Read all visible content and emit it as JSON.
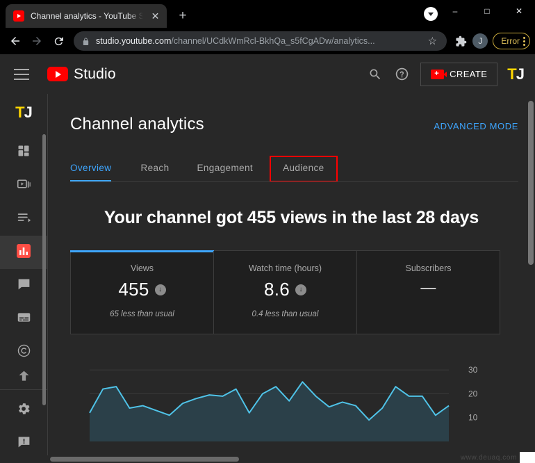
{
  "browser": {
    "tab": {
      "title": "Channel analytics - YouTube Stud",
      "favicon_name": "youtube-favicon",
      "close_label": "✕"
    },
    "new_tab_label": "+",
    "window_controls": {
      "minimize": "–",
      "maximize": "□",
      "close": "✕"
    },
    "toolbar": {
      "back_label": "←",
      "forward_label": "→",
      "reload_label": "⟳",
      "lock_name": "lock-icon",
      "url_host": "studio.youtube.com",
      "url_path": "/channel/UCdkWmRcl-BkhQa_s5fCgADw/analytics...",
      "bookmark_label": "☆",
      "extensions_label": "🧩",
      "avatar_initial": "J",
      "error_label": "Error"
    }
  },
  "studio": {
    "header": {
      "menu_name": "hamburger-menu",
      "logo_word": "Studio",
      "search_name": "search-icon",
      "help_name": "help-icon",
      "create_label": "CREATE",
      "account_initials_t": "T",
      "account_initials_j": "J"
    },
    "sidebar": {
      "avatar_t": "T",
      "avatar_j": "J",
      "items": [
        {
          "name": "dashboard",
          "icon": "dashboard-icon"
        },
        {
          "name": "content",
          "icon": "video-icon"
        },
        {
          "name": "playlists",
          "icon": "playlist-icon"
        },
        {
          "name": "analytics",
          "icon": "analytics-icon",
          "active": true
        },
        {
          "name": "comments",
          "icon": "comment-icon"
        },
        {
          "name": "subtitles",
          "icon": "subtitles-icon"
        },
        {
          "name": "copyright",
          "icon": "copyright-icon"
        },
        {
          "name": "monetization",
          "icon": "monetization-icon"
        }
      ],
      "footer_items": [
        {
          "name": "settings",
          "icon": "gear-icon"
        },
        {
          "name": "send-feedback",
          "icon": "feedback-icon"
        }
      ]
    },
    "main": {
      "page_title": "Channel analytics",
      "advanced_mode": "ADVANCED MODE",
      "tabs": [
        {
          "label": "Overview",
          "selected": true,
          "boxed": false
        },
        {
          "label": "Reach",
          "selected": false,
          "boxed": false
        },
        {
          "label": "Engagement",
          "selected": false,
          "boxed": false
        },
        {
          "label": "Audience",
          "selected": false,
          "boxed": true
        }
      ],
      "headline": "Your channel got 455 views in the last 28 days",
      "cards": [
        {
          "label": "Views",
          "value": "455",
          "trend": "down",
          "sub": "65 less than usual",
          "active": true
        },
        {
          "label": "Watch time (hours)",
          "value": "8.6",
          "trend": "down",
          "sub": "0.4 less than usual",
          "active": false
        },
        {
          "label": "Subscribers",
          "value": "—",
          "trend": "none",
          "sub": "",
          "active": false
        }
      ]
    }
  },
  "watermark": "www.deuaq.com",
  "colors": {
    "accent_blue": "#3ea6ff",
    "youtube_red": "#ff0000",
    "highlight_red": "#ff0000",
    "chart_line": "#4fc3e8",
    "page_bg": "#282828",
    "card_bg": "#1f1f1f",
    "error_gold": "#e2c35a"
  },
  "chart_data": {
    "type": "area",
    "title": "",
    "xlabel": "",
    "ylabel": "",
    "ylim": [
      0,
      35
    ],
    "yticks": [
      10,
      20,
      30
    ],
    "grid": true,
    "legend": "none",
    "series": [
      {
        "name": "Views",
        "values": [
          12,
          22,
          23,
          14,
          15,
          13,
          11,
          16,
          18,
          19.5,
          19,
          22,
          12,
          20,
          23,
          17,
          25,
          19,
          14.5,
          16.5,
          15,
          9,
          14,
          23,
          19,
          19,
          11,
          15
        ]
      }
    ]
  }
}
